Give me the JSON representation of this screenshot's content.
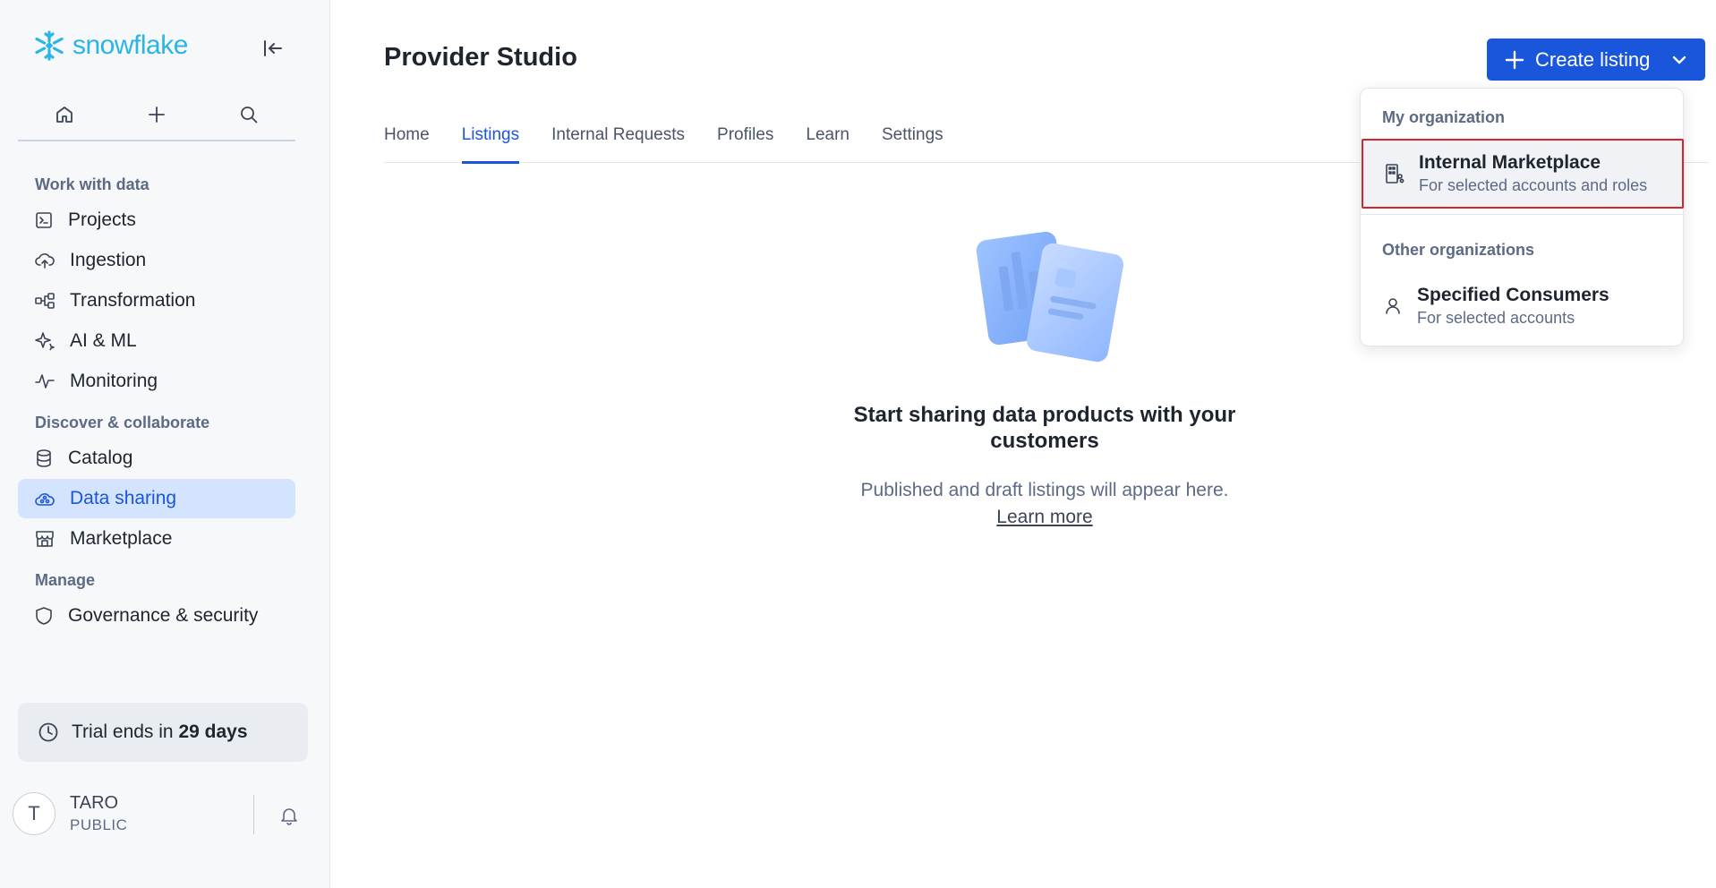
{
  "brand": {
    "name": "snowflake",
    "accent": "#29b5e8"
  },
  "sidebar": {
    "quick_actions": [
      {
        "icon": "home-icon"
      },
      {
        "icon": "plus-icon"
      },
      {
        "icon": "search-icon"
      }
    ],
    "sections": [
      {
        "label": "Work with data",
        "items": [
          {
            "label": "Projects",
            "icon": "terminal-icon"
          },
          {
            "label": "Ingestion",
            "icon": "cloud-upload-icon"
          },
          {
            "label": "Transformation",
            "icon": "flow-icon"
          },
          {
            "label": "AI & ML",
            "icon": "sparkle-icon"
          },
          {
            "label": "Monitoring",
            "icon": "pulse-icon"
          }
        ]
      },
      {
        "label": "Discover & collaborate",
        "items": [
          {
            "label": "Catalog",
            "icon": "database-icon"
          },
          {
            "label": "Data sharing",
            "icon": "share-cloud-icon",
            "active": true
          },
          {
            "label": "Marketplace",
            "icon": "storefront-icon"
          }
        ]
      },
      {
        "label": "Manage",
        "items": [
          {
            "label": "Governance & security",
            "icon": "shield-icon"
          }
        ]
      }
    ],
    "trial": {
      "prefix": "Trial ends in",
      "days": "29 days"
    },
    "user": {
      "initial": "T",
      "name": "TARO",
      "role": "PUBLIC"
    }
  },
  "header": {
    "title": "Provider Studio",
    "create_button": "Create listing"
  },
  "tabs": [
    {
      "label": "Home"
    },
    {
      "label": "Listings",
      "active": true
    },
    {
      "label": "Internal Requests"
    },
    {
      "label": "Profiles"
    },
    {
      "label": "Learn"
    },
    {
      "label": "Settings"
    }
  ],
  "empty_state": {
    "title": "Start sharing data products with your customers",
    "subtitle": "Published and draft listings will appear here.",
    "link": "Learn more"
  },
  "dropdown": {
    "group1_header": "My organization",
    "item1": {
      "label": "Internal Marketplace",
      "desc": "For selected accounts and roles"
    },
    "group2_header": "Other organizations",
    "item2": {
      "label": "Specified Consumers",
      "desc": "For selected accounts"
    }
  }
}
